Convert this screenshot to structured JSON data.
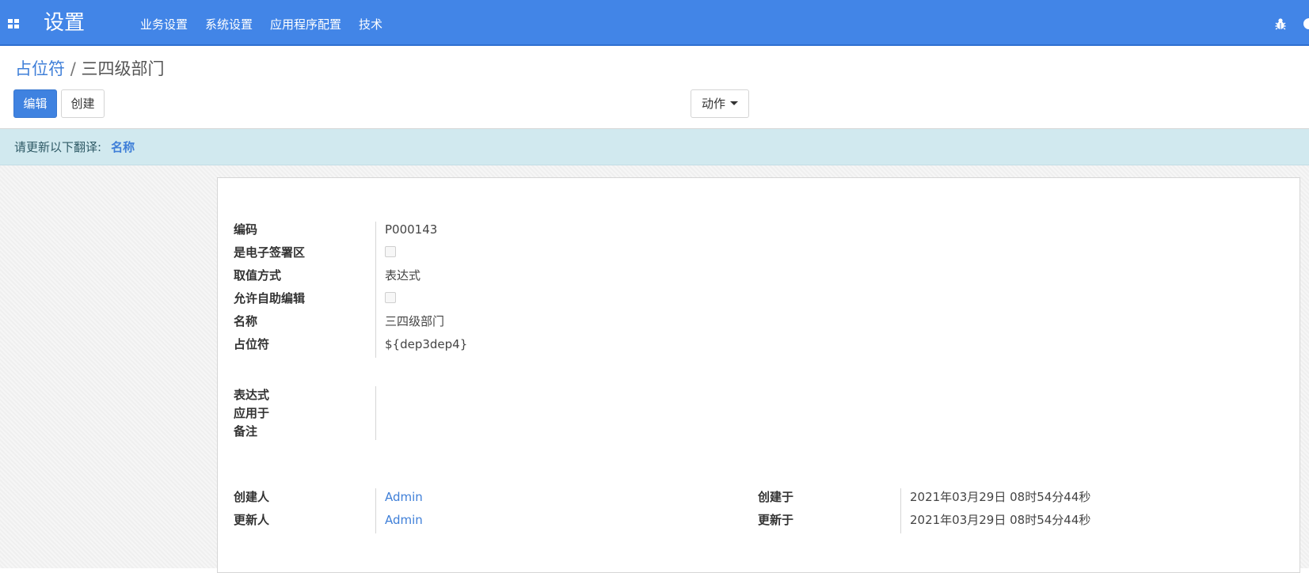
{
  "topbar": {
    "brand": "设置",
    "menu": [
      "业务设置",
      "系统设置",
      "应用程序配置",
      "技术"
    ]
  },
  "breadcrumb": {
    "parent": "占位符",
    "separator": "/",
    "current": "三四级部门"
  },
  "buttons": {
    "edit": "编辑",
    "create": "创建",
    "action": "动作"
  },
  "alert": {
    "text": "请更新以下翻译:",
    "link": "名称"
  },
  "fields": {
    "code_label": "编码",
    "code_value": "P000143",
    "esign_label": "是电子签署区",
    "method_label": "取值方式",
    "method_value": "表达式",
    "self_edit_label": "允许自助编辑",
    "name_label": "名称",
    "name_value": "三四级部门",
    "placeholder_label": "占位符",
    "placeholder_value": "${dep3dep4}",
    "expression_label": "表达式",
    "applies_label": "应用于",
    "notes_label": "备注",
    "creator_label": "创建人",
    "creator_value": "Admin",
    "updater_label": "更新人",
    "updater_value": "Admin",
    "created_on_label": "创建于",
    "created_on_value": "2021年03月29日 08时54分44秒",
    "updated_on_label": "更新于",
    "updated_on_value": "2021年03月29日 08时54分44秒"
  },
  "icons": {
    "apps": "apps-grid-icon",
    "debug": "bug-icon"
  },
  "colors": {
    "navbar": "#4285e7",
    "primary": "#3f82e0",
    "link": "#3f7fd8",
    "alert_bg": "#d1e9ef"
  }
}
